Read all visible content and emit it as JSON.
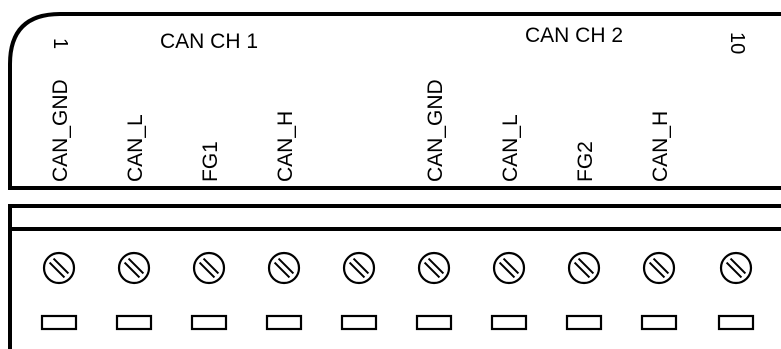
{
  "header": {
    "ch1": "CAN CH 1",
    "ch2": "CAN CH 2",
    "pin_first": "1",
    "pin_last": "10"
  },
  "pins": [
    {
      "label": "CAN_GND"
    },
    {
      "label": "CAN_L"
    },
    {
      "label": "FG1"
    },
    {
      "label": "CAN_H"
    },
    {
      "label": ""
    },
    {
      "label": "CAN_GND"
    },
    {
      "label": "CAN_L"
    },
    {
      "label": "FG2"
    },
    {
      "label": "CAN_H"
    },
    {
      "label": ""
    }
  ],
  "colors": {
    "line": "#000000",
    "background": "#ffffff"
  },
  "icons": {
    "screw": "screw-terminal-icon",
    "slot": "wire-slot-icon"
  }
}
